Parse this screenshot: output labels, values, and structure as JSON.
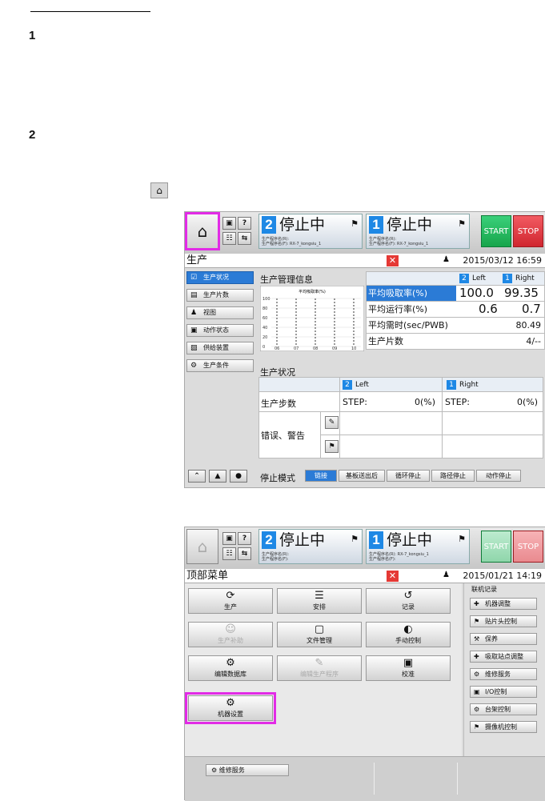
{
  "steps": [
    "1",
    "2"
  ],
  "home_icon": "home-icon",
  "screen1": {
    "lanes": [
      {
        "num": "2",
        "status": "停止中",
        "prog": "生产程序名(R):",
        "prog2": "生产程序名(F): RX-7_kongsiu_1"
      },
      {
        "num": "1",
        "status": "停止中",
        "prog": "生产程序名(R):",
        "prog2": "生产程序名(F): RX-7_kongsiu_1"
      }
    ],
    "start": "START",
    "stop": "STOP",
    "title": "生产",
    "datetime": "2015/03/12 16:59",
    "side": [
      "生产状况",
      "生产片数",
      "视图",
      "动作状态",
      "供给装置",
      "生产条件"
    ],
    "mgmt_title": "生产管理信息",
    "chart": {
      "title": "平均吸取率(%)",
      "y": [
        "100",
        "80",
        "60",
        "40",
        "20",
        "0"
      ],
      "x": [
        "06",
        "07",
        "08",
        "09",
        "10"
      ]
    },
    "stats_head": {
      "left_num": "2",
      "left": "Left",
      "right_num": "1",
      "right": "Right"
    },
    "stats": [
      {
        "label": "平均吸取率(%)",
        "l": "100.0",
        "r": "99.35"
      },
      {
        "label": "平均运行率(%)",
        "l": "0.6",
        "r": "0.7"
      },
      {
        "label": "平均需时(sec/PWB)",
        "v": "80.49"
      },
      {
        "label": "生产片数",
        "v": "4/--"
      }
    ],
    "status_title": "生产状况",
    "status_head": {
      "left_num": "2",
      "left": "Left",
      "right_num": "1",
      "right": "Right"
    },
    "steps_row": {
      "label": "生产步数",
      "l_key": "STEP:",
      "l_val": "0(%)",
      "r_key": "STEP:",
      "r_val": "0(%)"
    },
    "err_label": "错误、警告",
    "stop_mode": "停止模式",
    "stop_btns": [
      "链接",
      "基板送出后",
      "循环停止",
      "路径停止",
      "动作停止"
    ]
  },
  "screen2": {
    "lanes": [
      {
        "num": "2",
        "status": "停止中",
        "prog": "生产程序名(R):",
        "prog2": "生产程序名(F):"
      },
      {
        "num": "1",
        "status": "停止中",
        "prog": "生产程序名(R): RX-7_kongsiu_1",
        "prog2": "生产程序名(F):"
      }
    ],
    "start": "START",
    "stop": "STOP",
    "title": "顶部菜单",
    "datetime": "2015/01/21 14:19",
    "menu": [
      {
        "label": "生产",
        "icon": "⟳"
      },
      {
        "label": "安排",
        "icon": "☰"
      },
      {
        "label": "记录",
        "icon": "↺"
      },
      {
        "label": "生产补助",
        "icon": "☺"
      },
      {
        "label": "文件管理",
        "icon": "▢"
      },
      {
        "label": "手动控制",
        "icon": "◐"
      },
      {
        "label": "编辑数据库",
        "icon": "⚙"
      },
      {
        "label": "编辑生产程序",
        "icon": "✎"
      },
      {
        "label": "校准",
        "icon": "▣"
      },
      {
        "label": "机器设置",
        "icon": "⚙"
      }
    ],
    "right_title": "联机记录",
    "right": [
      "机器调整",
      "贴片头控制",
      "保养",
      "吸取站点调整",
      "维修服务",
      "I/O控制",
      "台架控制",
      "摄像机控制"
    ],
    "bottom": "维修服务"
  }
}
